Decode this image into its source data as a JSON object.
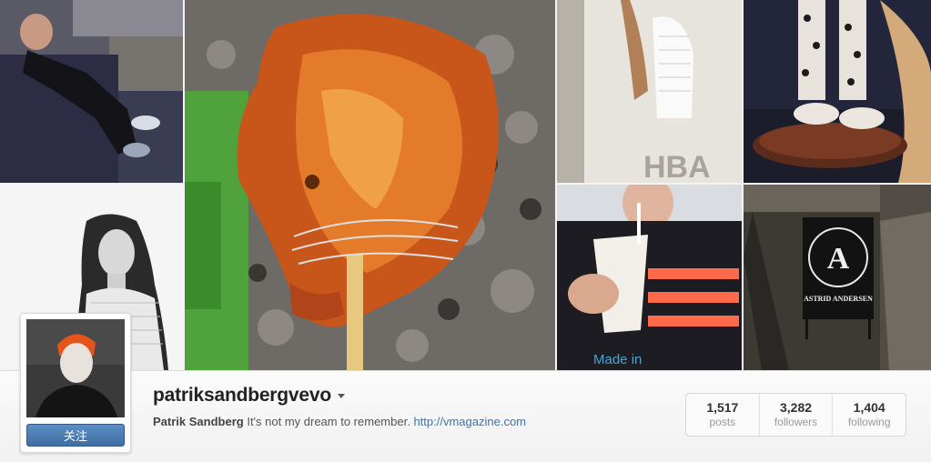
{
  "profile": {
    "username": "patriksandbergvevo",
    "full_name": "Patrik Sandberg",
    "bio": "It's not my dream to remember.",
    "website": "http://vmagazine.com",
    "follow_label": "关注"
  },
  "stats": [
    {
      "value": "1,517",
      "label": "posts"
    },
    {
      "value": "3,282",
      "label": "followers"
    },
    {
      "value": "1,404",
      "label": "following"
    }
  ],
  "photos": {
    "hba_sign": "HBA",
    "made_in_text": "Made in",
    "astrid_sign": "ASTRID ANDERSEN",
    "astrid_letter": "A"
  },
  "colors": {
    "accent_blue": "#3e6fa3",
    "link": "#3f72af"
  }
}
